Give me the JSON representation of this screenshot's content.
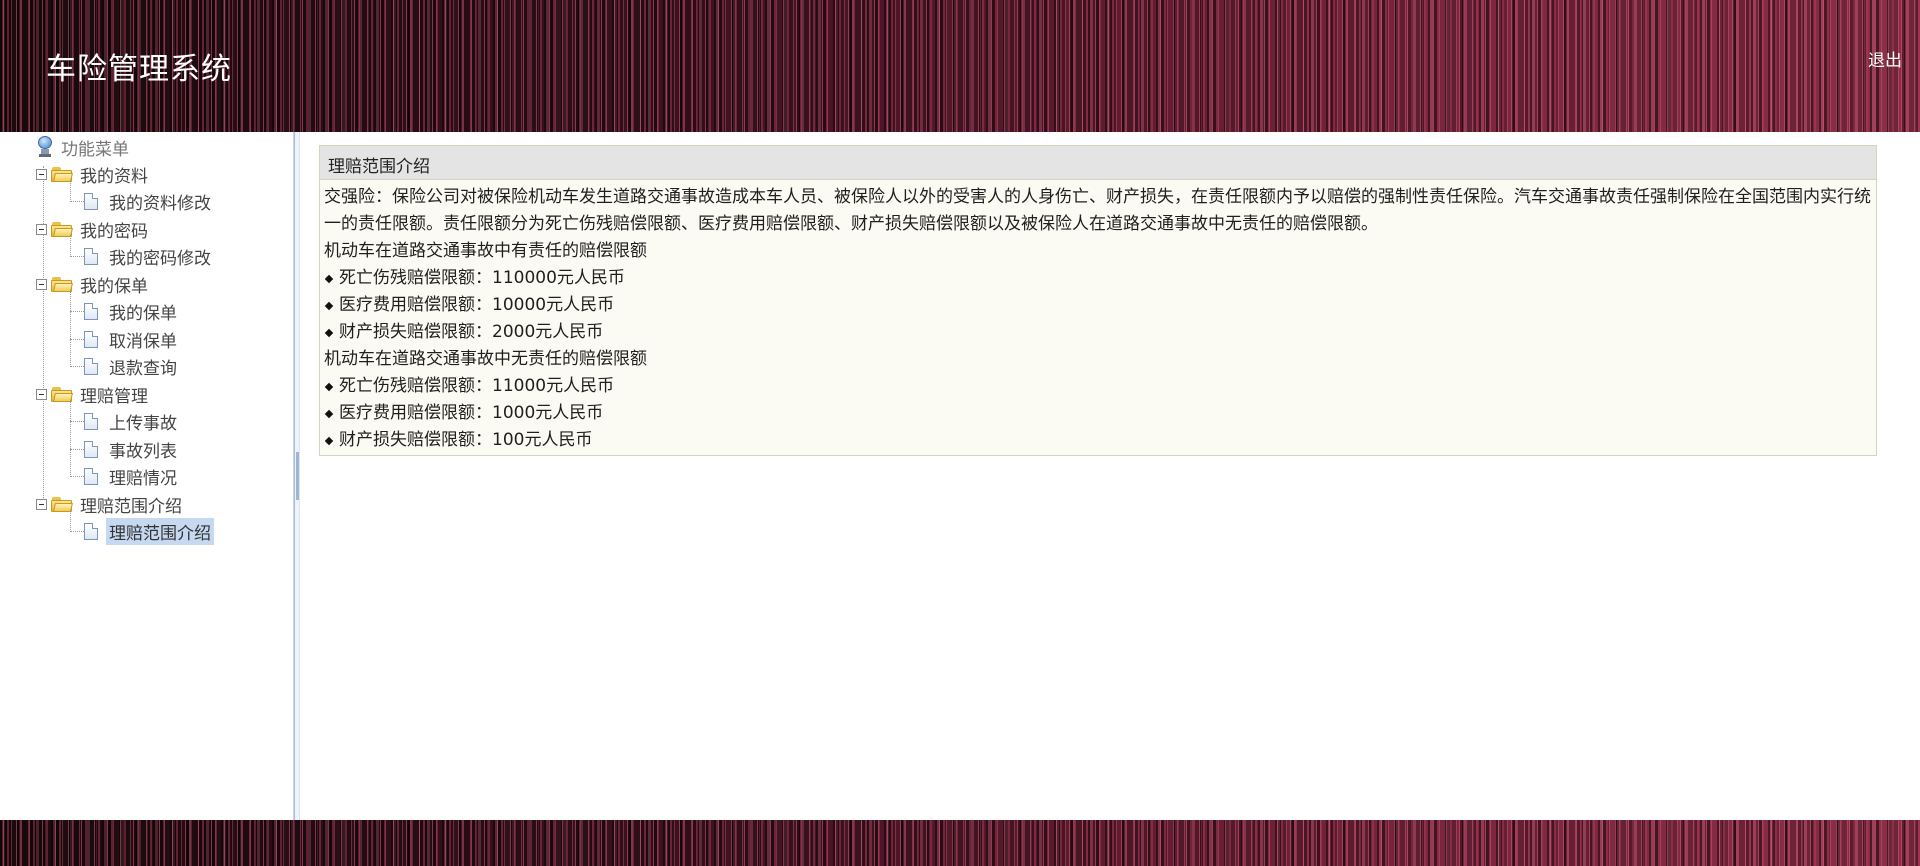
{
  "header": {
    "title": "车险管理系统",
    "logout_label": "退出"
  },
  "menu": {
    "root_label": "功能菜单",
    "groups": [
      {
        "label": "我的资料",
        "items": [
          {
            "label": "我的资料修改"
          }
        ]
      },
      {
        "label": "我的密码",
        "items": [
          {
            "label": "我的密码修改"
          }
        ]
      },
      {
        "label": "我的保单",
        "items": [
          {
            "label": "我的保单"
          },
          {
            "label": "取消保单"
          },
          {
            "label": "退款查询"
          }
        ]
      },
      {
        "label": "理赔管理",
        "items": [
          {
            "label": "上传事故"
          },
          {
            "label": "事故列表"
          },
          {
            "label": "理赔情况"
          }
        ]
      },
      {
        "label": "理赔范围介绍",
        "items": [
          {
            "label": "理赔范围介绍",
            "selected": true
          }
        ]
      }
    ]
  },
  "panel": {
    "title": "理赔范围介绍",
    "intro": "交强险：保险公司对被保险机动车发生道路交通事故造成本车人员、被保险人以外的受害人的人身伤亡、财产损失，在责任限额内予以赔偿的强制性责任保险。汽车交通事故责任强制保险在全国范围内实行统一的责任限额。责任限额分为死亡伤残赔偿限额、医疗费用赔偿限额、财产损失赔偿限额以及被保险人在道路交通事故中无责任的赔偿限额。",
    "sections": [
      {
        "heading": "机动车在道路交通事故中有责任的赔偿限额",
        "items": [
          "死亡伤残赔偿限额：110000元人民币",
          "医疗费用赔偿限额：10000元人民币",
          "财产损失赔偿限额：2000元人民币"
        ]
      },
      {
        "heading": "机动车在道路交通事故中无责任的赔偿限额",
        "items": [
          "死亡伤残赔偿限额：11000元人民币",
          "医疗费用赔偿限额：1000元人民币",
          "财产损失赔偿限额：100元人民币"
        ]
      }
    ]
  },
  "colors": {
    "header_bg": "#3a1220",
    "selected_bg": "#c6d9f1",
    "panel_bg": "#fbfbf3",
    "panel_header_bg": "#e4e4e4"
  }
}
